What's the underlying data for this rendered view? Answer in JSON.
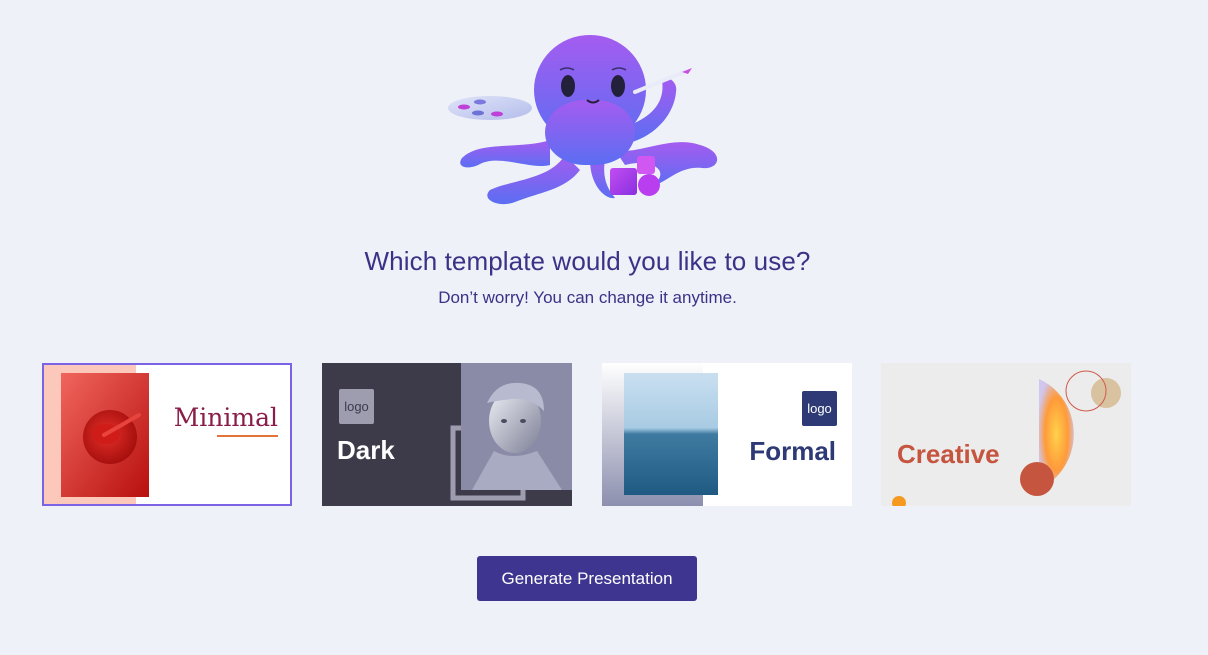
{
  "header": {
    "title": "Which template would you like to use?",
    "subtitle": "Don’t worry! You can change it anytime."
  },
  "mascot": {
    "icon": "octopus-painter-illustration"
  },
  "templates": [
    {
      "name": "Minimal",
      "selected": true,
      "accent": "#8a1c4a"
    },
    {
      "name": "Dark",
      "selected": false,
      "logo_text": "logo",
      "accent": "#3d3a4a"
    },
    {
      "name": "Formal",
      "selected": false,
      "logo_text": "logo",
      "accent": "#2e3a75"
    },
    {
      "name": "Creative",
      "selected": false,
      "accent": "#c6553f"
    }
  ],
  "actions": {
    "generate_label": "Generate Presentation"
  },
  "colors": {
    "primary": "#3e3590",
    "background": "#eef1f8",
    "selection": "#7b63e6"
  }
}
